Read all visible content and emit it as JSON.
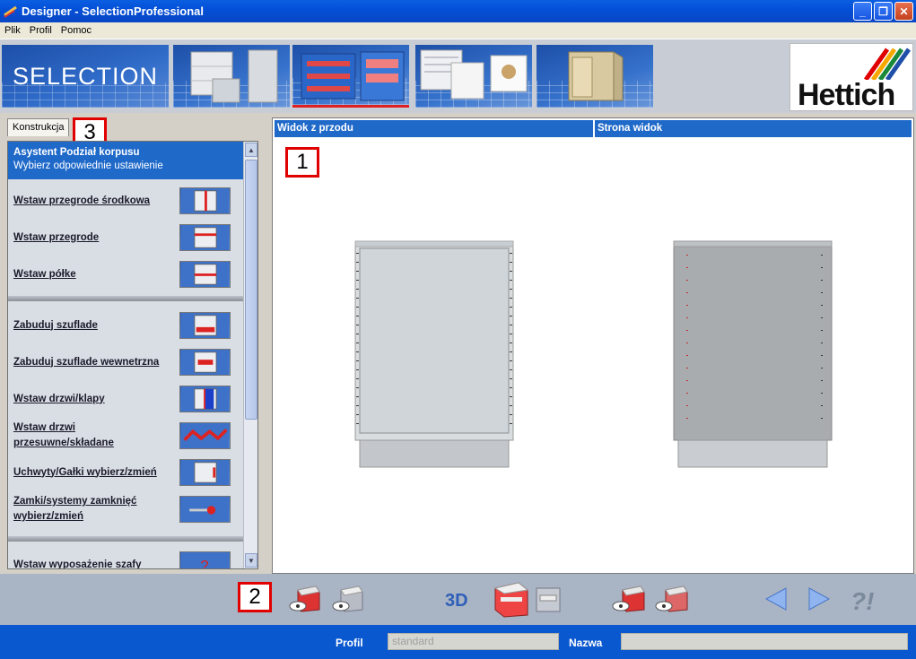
{
  "window": {
    "title": "Designer - SelectionProfessional"
  },
  "menu": [
    "Plik",
    "Profil",
    "Pomoc"
  ],
  "banner": {
    "logo_text": "SELECTION",
    "brand": "Hettich"
  },
  "left_panel": {
    "tab": "Konstrukcja",
    "header_title": "Asystent Podział korpusu",
    "header_subtitle": "Wybierz odpowiednie ustawienie",
    "items": [
      {
        "label": "Wstaw przegrode środkowa",
        "icon": "center-divider-icon"
      },
      {
        "label": "Wstaw przegrode",
        "icon": "divider-icon"
      },
      {
        "label": "Wstaw półke",
        "icon": "shelf-icon"
      },
      {
        "label": "Zabuduj szuflade",
        "icon": "drawer-icon"
      },
      {
        "label": "Zabuduj szuflade wewnetrzna",
        "icon": "inner-drawer-icon"
      },
      {
        "label": "Wstaw drzwi/klapy",
        "icon": "door-icon"
      },
      {
        "label": "Wstaw drzwi przesuwne/składane",
        "icon": "sliding-door-icon"
      },
      {
        "label": "Uchwyty/Gałki wybierz/zmień",
        "icon": "handle-icon"
      },
      {
        "label": "Zamki/systemy zamknięć wybierz/zmień",
        "icon": "lock-icon"
      },
      {
        "label": "Wstaw wyposażenie szafy",
        "icon": "help-icon"
      }
    ]
  },
  "view": {
    "front_label": "Widok z przodu",
    "side_label": "Strona widok"
  },
  "markers": {
    "one": "1",
    "two": "2",
    "three": "3"
  },
  "toolbar": {
    "mode_3d": "3D"
  },
  "status": {
    "profile_label": "Profil",
    "profile_value": "standard",
    "name_label": "Nazwa",
    "name_value": ""
  },
  "colors": {
    "accent_blue": "#1f69c9",
    "marker_red": "#e00000",
    "status_blue": "#0a58d0"
  }
}
